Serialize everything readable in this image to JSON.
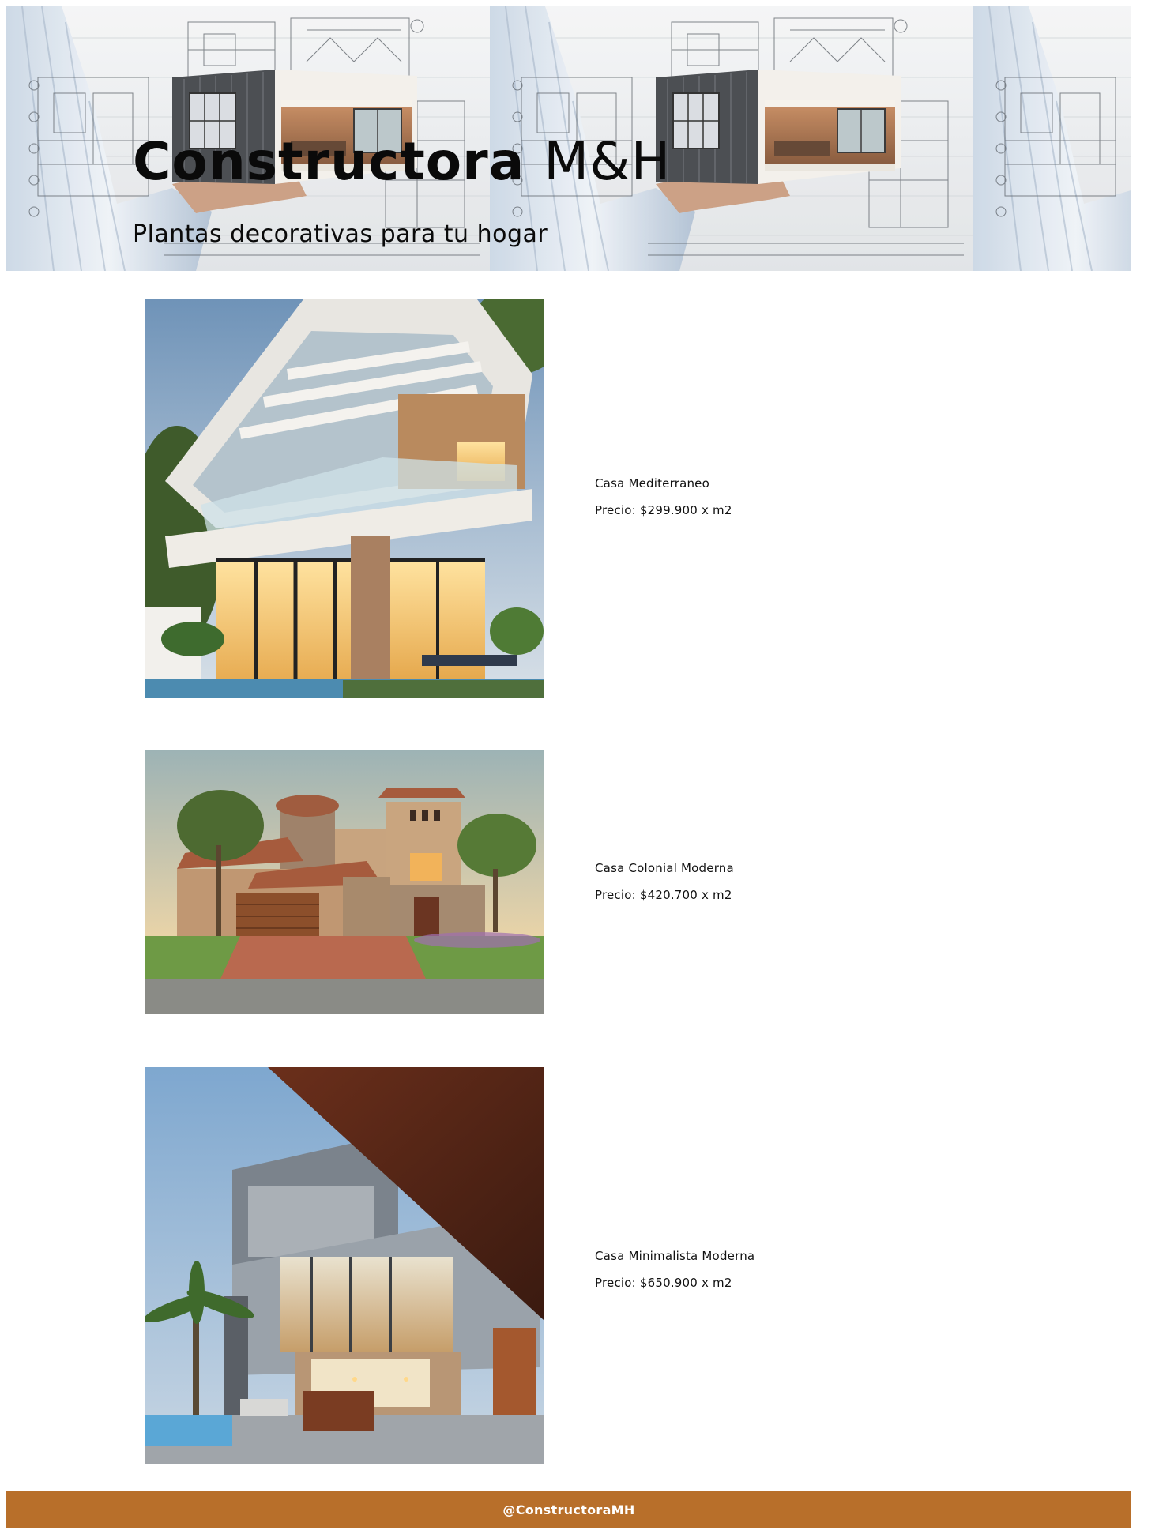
{
  "header": {
    "title_bold": "Constructora",
    "title_light": "M&H",
    "subtitle": "Plantas decorativas para tu hogar"
  },
  "products": [
    {
      "name": "Casa Mediterraneo",
      "price": "Precio: $299.900 x m2"
    },
    {
      "name": "Casa Colonial Moderna",
      "price": "Precio: $420.700 x m2"
    },
    {
      "name": "Casa Minimalista Moderna",
      "price": "Precio: $650.900 x m2"
    }
  ],
  "footer": {
    "handle": "@ConstructoraMH"
  },
  "colors": {
    "footer_bg": "#b86f2a",
    "footer_text": "#ffffff"
  }
}
